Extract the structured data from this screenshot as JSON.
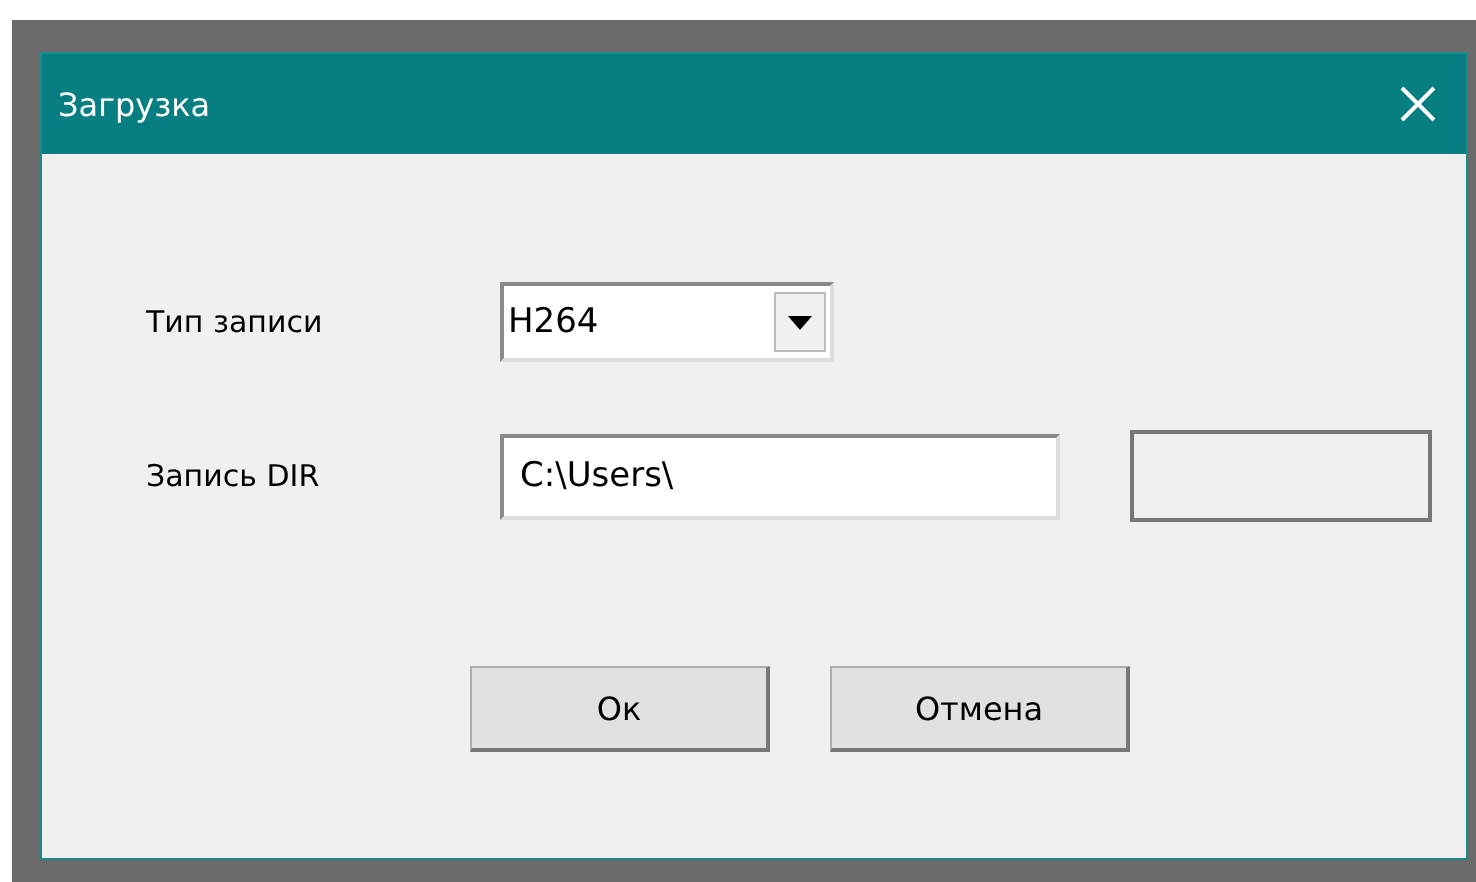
{
  "window": {
    "title": "Загрузка"
  },
  "fields": [
    {
      "kind": "combo",
      "label": "Тип записи",
      "value": "H264"
    },
    {
      "kind": "path",
      "label": "Запись DIR",
      "value": "C:\\Users\\"
    }
  ],
  "buttons": [
    "Ок",
    "Отмена"
  ]
}
